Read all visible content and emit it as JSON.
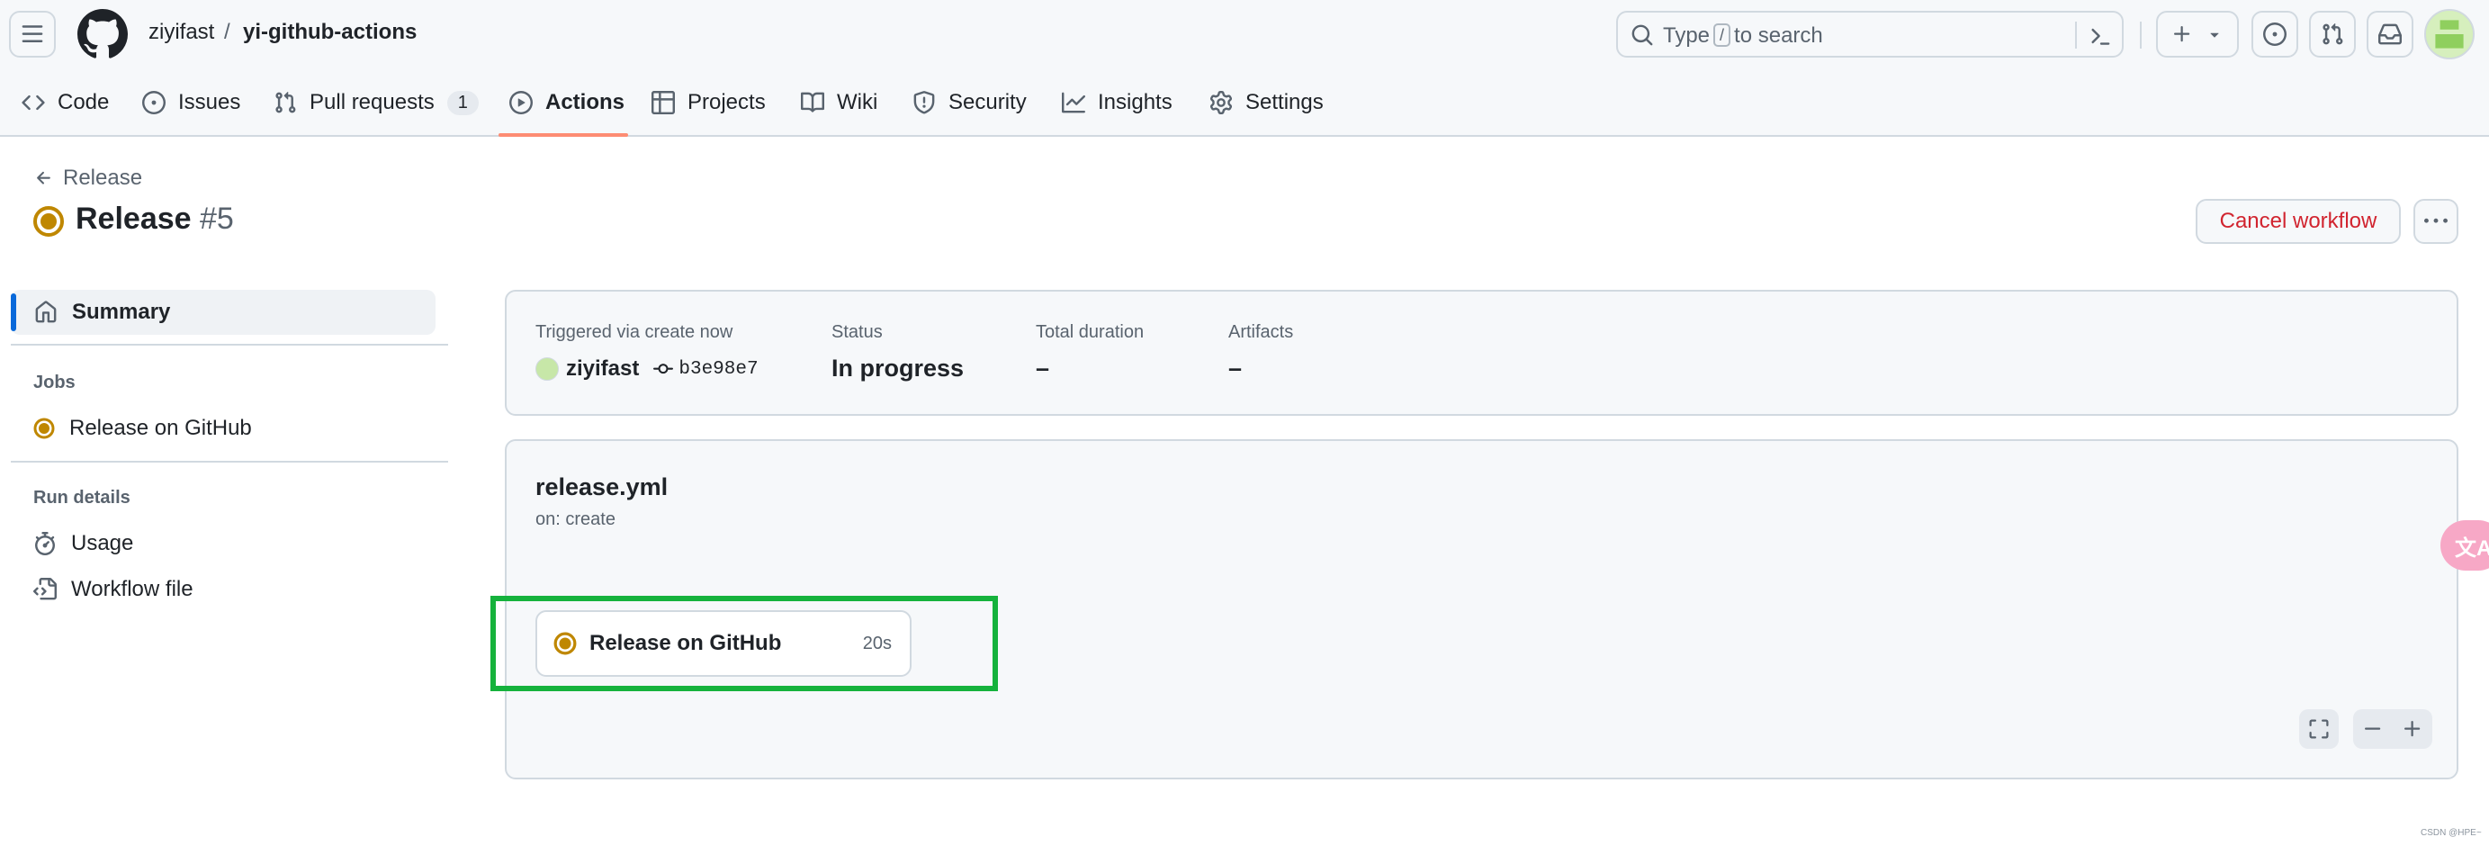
{
  "header": {
    "owner": "ziyifast",
    "separator": "/",
    "repo": "yi-github-actions",
    "search": {
      "prefix": "Type",
      "key": "/",
      "suffix": "to search"
    }
  },
  "repo_nav": {
    "items": [
      {
        "label": "Code",
        "icon": "code-icon"
      },
      {
        "label": "Issues",
        "icon": "issue-opened-icon"
      },
      {
        "label": "Pull requests",
        "icon": "git-pull-request-icon",
        "counter": "1"
      },
      {
        "label": "Actions",
        "icon": "play-icon",
        "active": true
      },
      {
        "label": "Projects",
        "icon": "table-icon"
      },
      {
        "label": "Wiki",
        "icon": "book-icon"
      },
      {
        "label": "Security",
        "icon": "shield-icon"
      },
      {
        "label": "Insights",
        "icon": "graph-icon"
      },
      {
        "label": "Settings",
        "icon": "gear-icon"
      }
    ]
  },
  "run": {
    "back_label": "Release",
    "title": "Release",
    "number": "#5",
    "cancel_label": "Cancel workflow"
  },
  "sidebar": {
    "summary_label": "Summary",
    "jobs_heading": "Jobs",
    "jobs": [
      {
        "label": "Release on GitHub"
      }
    ],
    "run_details_heading": "Run details",
    "details": [
      {
        "label": "Usage",
        "icon": "stopwatch-icon"
      },
      {
        "label": "Workflow file",
        "icon": "file-code-icon"
      }
    ]
  },
  "summary": {
    "trigger_label": "Triggered via create now",
    "actor": "ziyifast",
    "commit": "b3e98e7",
    "status_label": "Status",
    "status_value": "In progress",
    "duration_label": "Total duration",
    "duration_value": "–",
    "artifacts_label": "Artifacts",
    "artifacts_value": "–"
  },
  "workflow": {
    "file": "release.yml",
    "trigger": "on: create",
    "job": {
      "name": "Release on GitHub",
      "time": "20s"
    }
  },
  "floating": {
    "translate_glyph": "文A"
  },
  "watermark": "CSDN @HPE~",
  "colors": {
    "accent_blue": "#0969da",
    "in_progress": "#bf8700",
    "danger": "#d1242f",
    "highlight": "#15b23c",
    "tab_underline": "#fd8c73"
  }
}
